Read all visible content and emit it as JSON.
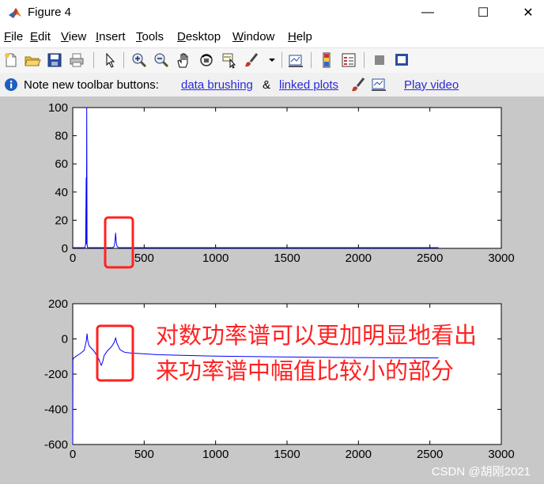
{
  "window": {
    "title": "Figure 4"
  },
  "window_controls": {
    "minimize": "—",
    "maximize": "☐",
    "close": "✕"
  },
  "menu": [
    {
      "underline": "F",
      "rest": "ile"
    },
    {
      "underline": "E",
      "rest": "dit"
    },
    {
      "underline": "V",
      "rest": "iew"
    },
    {
      "underline": "I",
      "rest": "nsert"
    },
    {
      "underline": "T",
      "rest": "ools"
    },
    {
      "underline": "D",
      "rest": "esktop"
    },
    {
      "underline": "W",
      "rest": "indow"
    },
    {
      "underline": "H",
      "rest": "elp"
    }
  ],
  "toolbar_icons": [
    "new-figure-icon",
    "open-file-icon",
    "save-icon",
    "print-icon",
    "edit-plot-arrow-icon",
    "zoom-in-icon",
    "zoom-out-icon",
    "pan-hand-icon",
    "rotate-3d-icon",
    "data-cursor-icon",
    "brush-icon",
    "link-plot-icon",
    "colorbar-icon",
    "legend-icon",
    "hide-plot-tools-icon",
    "show-plot-tools-icon"
  ],
  "notification": {
    "prefix": "Note new toolbar buttons: ",
    "link1": "data brushing",
    "amp": " & ",
    "link2": "linked plots",
    "link3": "Play video"
  },
  "annotation": {
    "line1": "对数功率谱可以更加明显地看出",
    "line2": "来功率谱中幅值比较小的部分",
    "color": "#ff2222"
  },
  "watermark": "CSDN @胡刚2021",
  "colors": {
    "line": "#0000ff",
    "highlight_box": "#ff2222",
    "figure_bg": "#c8c8c8"
  },
  "chart_data": [
    {
      "type": "line",
      "title": "",
      "xlabel": "",
      "ylabel": "",
      "xlim": [
        0,
        3000
      ],
      "ylim": [
        0,
        100
      ],
      "xticks": [
        0,
        500,
        1000,
        1500,
        2000,
        2500,
        3000
      ],
      "yticks": [
        0,
        20,
        40,
        60,
        80,
        100
      ],
      "series": [
        {
          "x": [
            0,
            85,
            90,
            94,
            95,
            96,
            98,
            100,
            104,
            110,
            280,
            290,
            295,
            300,
            305,
            310,
            320,
            2560
          ],
          "y": [
            0.5,
            0.5,
            3,
            50,
            50,
            3,
            100,
            3,
            0.5,
            0.5,
            0.5,
            1.5,
            4,
            11,
            4,
            1.5,
            0.5,
            0.5
          ]
        }
      ]
    },
    {
      "type": "line",
      "title": "",
      "xlabel": "",
      "ylabel": "",
      "xlim": [
        0,
        3000
      ],
      "ylim": [
        -600,
        200
      ],
      "xticks": [
        0,
        500,
        1000,
        1500,
        2000,
        2500,
        3000
      ],
      "yticks": [
        -600,
        -400,
        -200,
        0,
        200
      ],
      "series": [
        {
          "x": [
            0,
            1,
            5,
            20,
            50,
            80,
            95,
            100,
            105,
            115,
            150,
            180,
            200,
            210,
            220,
            240,
            270,
            290,
            300,
            310,
            330,
            360,
            400,
            600,
            1000,
            1500,
            2000,
            2500,
            2560
          ],
          "y": [
            -600,
            -120,
            -110,
            -100,
            -85,
            -65,
            -10,
            30,
            -10,
            -40,
            -70,
            -110,
            -150,
            -130,
            -95,
            -70,
            -45,
            -20,
            5,
            -25,
            -60,
            -75,
            -80,
            -90,
            -98,
            -103,
            -106,
            -108,
            -108
          ]
        }
      ]
    }
  ]
}
